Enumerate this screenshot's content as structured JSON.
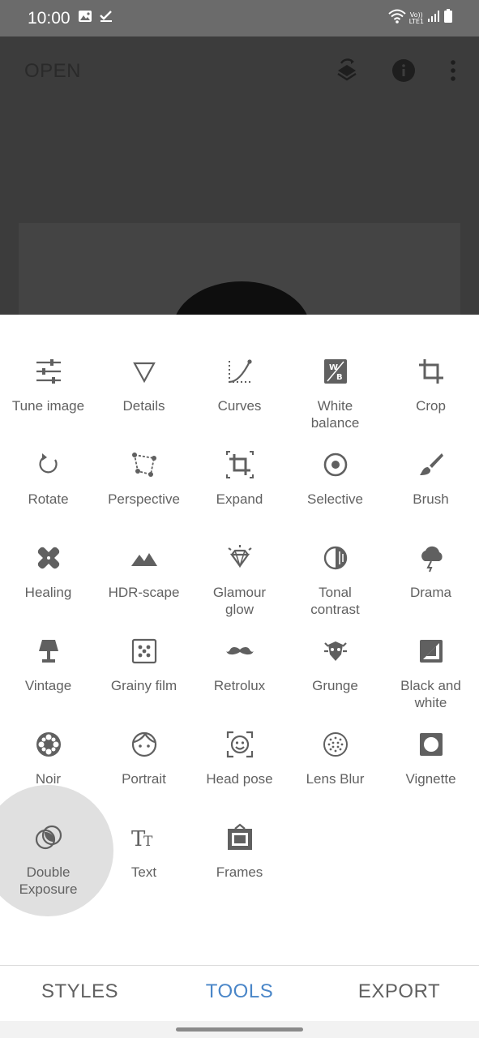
{
  "status_bar": {
    "time": "10:00",
    "network_label_top": "Vo))",
    "network_label_bottom": "LTE1"
  },
  "app": {
    "open_label": "OPEN",
    "icons": [
      "layers-sync-icon",
      "info-icon",
      "more-vert-icon"
    ]
  },
  "tools": [
    {
      "label": "Tune image",
      "icon": "tune-icon"
    },
    {
      "label": "Details",
      "icon": "details-triangle-icon"
    },
    {
      "label": "Curves",
      "icon": "curves-icon"
    },
    {
      "label": "White\nbalance",
      "icon": "white-balance-icon"
    },
    {
      "label": "Crop",
      "icon": "crop-icon"
    },
    {
      "label": "Rotate",
      "icon": "rotate-icon"
    },
    {
      "label": "Perspective",
      "icon": "perspective-icon"
    },
    {
      "label": "Expand",
      "icon": "expand-icon"
    },
    {
      "label": "Selective",
      "icon": "selective-icon"
    },
    {
      "label": "Brush",
      "icon": "brush-icon"
    },
    {
      "label": "Healing",
      "icon": "healing-icon"
    },
    {
      "label": "HDR-scape",
      "icon": "mountains-icon"
    },
    {
      "label": "Glamour\nglow",
      "icon": "diamond-icon"
    },
    {
      "label": "Tonal\ncontrast",
      "icon": "tonal-contrast-icon"
    },
    {
      "label": "Drama",
      "icon": "storm-cloud-icon"
    },
    {
      "label": "Vintage",
      "icon": "lamp-icon"
    },
    {
      "label": "Grainy film",
      "icon": "film-grain-icon"
    },
    {
      "label": "Retrolux",
      "icon": "mustache-icon"
    },
    {
      "label": "Grunge",
      "icon": "grunge-icon"
    },
    {
      "label": "Black and\nwhite",
      "icon": "black-white-icon"
    },
    {
      "label": "Noir",
      "icon": "film-reel-icon"
    },
    {
      "label": "Portrait",
      "icon": "face-icon"
    },
    {
      "label": "Head pose",
      "icon": "head-pose-icon"
    },
    {
      "label": "Lens Blur",
      "icon": "lens-blur-icon"
    },
    {
      "label": "Vignette",
      "icon": "vignette-icon"
    },
    {
      "label": "Double\nExposure",
      "icon": "double-exposure-icon"
    },
    {
      "label": "Text",
      "icon": "text-icon"
    },
    {
      "label": "Frames",
      "icon": "frames-icon"
    }
  ],
  "tabs": [
    {
      "label": "STYLES",
      "active": false
    },
    {
      "label": "TOOLS",
      "active": true
    },
    {
      "label": "EXPORT",
      "active": false
    }
  ],
  "colors": {
    "accent": "#4a86c8",
    "icon": "#606060",
    "status_bar": "#6b6b6b",
    "dim_overlay": "#3c3c3c"
  }
}
